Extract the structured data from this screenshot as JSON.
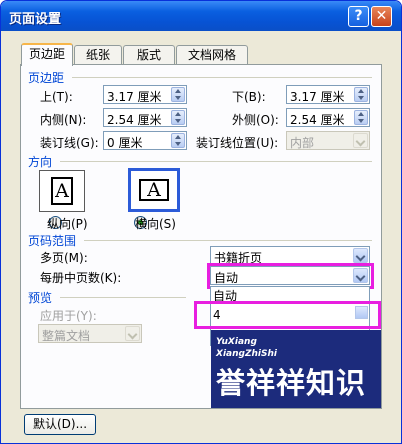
{
  "window": {
    "title": "页面设置",
    "help_label": "?",
    "close_label": "✕",
    "help_icon": "question-mark-icon",
    "close_icon": "close-x-icon"
  },
  "tabs": [
    {
      "label": "页边距",
      "active": true
    },
    {
      "label": "纸张",
      "active": false
    },
    {
      "label": "版式",
      "active": false
    },
    {
      "label": "文档网格",
      "active": false
    }
  ],
  "margins": {
    "section_title": "页边距",
    "top_label": "上(T):",
    "top_value": "3.17 厘米",
    "bottom_label": "下(B):",
    "bottom_value": "3.17 厘米",
    "inner_label": "内侧(N):",
    "inner_value": "2.54 厘米",
    "outer_label": "外侧(O):",
    "outer_value": "2.54 厘米",
    "gutter_label": "装订线(G):",
    "gutter_value": "0 厘米",
    "gutter_pos_label": "装订线位置(U):",
    "gutter_pos_value": "内部"
  },
  "orientation": {
    "section_title": "方向",
    "portrait_glyph": "A",
    "landscape_glyph": "A",
    "portrait_label": "纵向(P)",
    "landscape_label": "横向(S)",
    "selected": "landscape"
  },
  "pages": {
    "section_title": "页码范围",
    "multiple_label": "多页(M):",
    "multiple_value": "书籍折页",
    "sheets_label": "每册中页数(K):",
    "sheets_value": "自动",
    "dropdown_options": [
      "自动",
      "4"
    ]
  },
  "preview": {
    "section_title": "预览",
    "apply_label": "应用于(Y):",
    "apply_value": "整篇文档"
  },
  "footer": {
    "default_button": "默认(D)..."
  },
  "watermark": {
    "line1": "YuXiang",
    "line2": "XiangZhiShi",
    "main": "誉祥祥知识"
  },
  "colors": {
    "titlebar": "#0a5fe0",
    "section_title": "#0046d5",
    "highlight": "#e81ee0",
    "watermark_bg": "#1c2b7c"
  }
}
